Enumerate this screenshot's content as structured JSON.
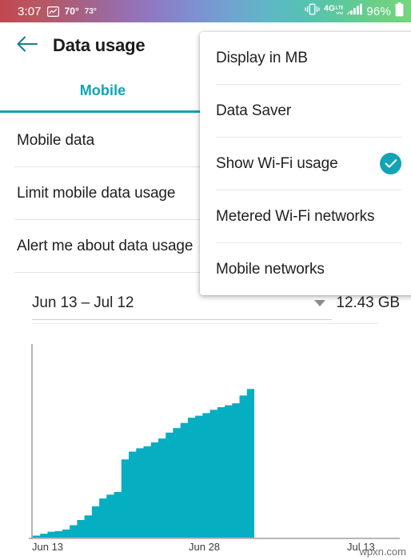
{
  "status_bar": {
    "time": "3:07",
    "weather_icon": "weather-graph-icon",
    "temp_primary": "70°",
    "temp_secondary": "73°",
    "vibrate_icon": "vibrate-icon",
    "network_type": "4G",
    "network_suffix": "LTE",
    "signal_icon": "signal-bars-icon",
    "battery_percent": "96%",
    "battery_icon": "battery-full-icon"
  },
  "app_bar": {
    "back_icon": "back-arrow-icon",
    "title": "Data usage"
  },
  "tabs": [
    {
      "label": "Mobile",
      "selected": true
    }
  ],
  "settings": [
    {
      "label": "Mobile data"
    },
    {
      "label": "Limit mobile data usage"
    },
    {
      "label": "Alert me about data usage"
    }
  ],
  "cycle": {
    "range": "Jun 13 – Jul 12",
    "caret_icon": "chevron-down-icon",
    "total": "12.43 GB"
  },
  "menu": {
    "items": [
      {
        "label": "Display in MB",
        "checked": false
      },
      {
        "label": "Data Saver",
        "checked": false
      },
      {
        "label": "Show Wi-Fi usage",
        "checked": true,
        "check_icon": "check-circle-icon"
      },
      {
        "label": "Metered Wi-Fi networks",
        "checked": false
      },
      {
        "label": "Mobile networks",
        "checked": false
      }
    ]
  },
  "colors": {
    "accent": "#12a3b4",
    "chart_fill": "#06aec2",
    "title": "#1c1c1c"
  },
  "watermark": "wpxn.com",
  "chart_data": {
    "type": "area",
    "title": "",
    "xlabel": "",
    "ylabel": "",
    "grid": false,
    "legend": false,
    "unit": "GB",
    "x_tick_labels": [
      "Jun 13",
      "Jun 28",
      "Jul 13"
    ],
    "x_tick_positions": [
      0,
      15,
      30
    ],
    "xlim": [
      0,
      30
    ],
    "ylim": [
      0,
      13.5
    ],
    "cumulative": true,
    "x": [
      0,
      1,
      2,
      3,
      4,
      5,
      6,
      7,
      8,
      9,
      10,
      11,
      12,
      13,
      14,
      15,
      16,
      17,
      18,
      19,
      20,
      21,
      22,
      23,
      24,
      25,
      26,
      27,
      28,
      29,
      30
    ],
    "values": [
      0.15,
      0.3,
      0.45,
      0.5,
      0.62,
      0.95,
      1.35,
      1.7,
      2.4,
      3.0,
      3.3,
      3.5,
      6.0,
      6.6,
      6.85,
      7.0,
      7.3,
      7.6,
      8.05,
      8.4,
      8.8,
      9.2,
      9.35,
      9.55,
      9.8,
      10.0,
      10.15,
      10.3,
      10.9,
      11.4,
      12.43
    ]
  }
}
